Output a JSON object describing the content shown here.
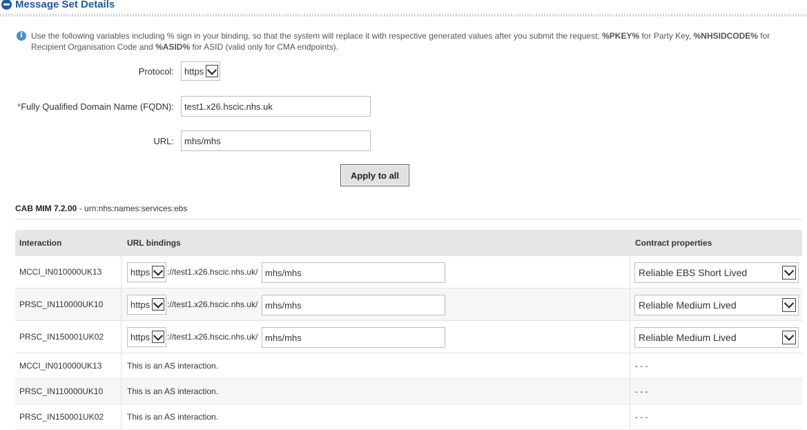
{
  "header": {
    "title": "Message Set Details"
  },
  "info": {
    "pre": "Use the following variables including % sign in your binding, so that the system will replace it with respective generated values after you submit the request; ",
    "var_pkey": "%PKEY%",
    "mid1": " for Party Key, ",
    "var_nhsid": "%NHSIDCODE%",
    "mid2": " for Recipient Organisation Code and ",
    "var_asid": "%ASID%",
    "post": " for ASID (valid only for CMA endpoints)."
  },
  "form": {
    "protocol_label": "Protocol:",
    "protocol_value": "https",
    "fqdn_required_mark": "*",
    "fqdn_label": "Fully Qualified Domain Name (FQDN):",
    "fqdn_value": "test1.x26.hscic.nhs.uk",
    "url_label": "URL:",
    "url_value": "mhs/mhs",
    "apply_label": "Apply to all"
  },
  "section": {
    "name": "CAB MIM 7.2.00",
    "suffix": " - urn:nhs:names:services:ebs"
  },
  "table": {
    "headers": {
      "interaction": "Interaction",
      "url_bindings": "URL bindings",
      "contract": "Contract properties"
    },
    "editable_rows": [
      {
        "interaction": "MCCI_IN010000UK13",
        "protocol": "https",
        "prefix": "://test1.x26.hscic.nhs.uk/",
        "path": "mhs/mhs",
        "contract": "Reliable EBS Short Lived"
      },
      {
        "interaction": "PRSC_IN110000UK10",
        "protocol": "https",
        "prefix": "://test1.x26.hscic.nhs.uk/",
        "path": "mhs/mhs",
        "contract": "Reliable Medium Lived"
      },
      {
        "interaction": "PRSC_IN150001UK02",
        "protocol": "https",
        "prefix": "://test1.x26.hscic.nhs.uk/",
        "path": "mhs/mhs",
        "contract": "Reliable Medium Lived"
      }
    ],
    "as_rows": [
      {
        "interaction": "MCCI_IN010000UK13",
        "note": "This is an AS interaction.",
        "contract": "- - -"
      },
      {
        "interaction": "PRSC_IN110000UK10",
        "note": "This is an AS interaction.",
        "contract": "- - -"
      },
      {
        "interaction": "PRSC_IN150001UK02",
        "note": "This is an AS interaction.",
        "contract": "- - -"
      }
    ]
  }
}
